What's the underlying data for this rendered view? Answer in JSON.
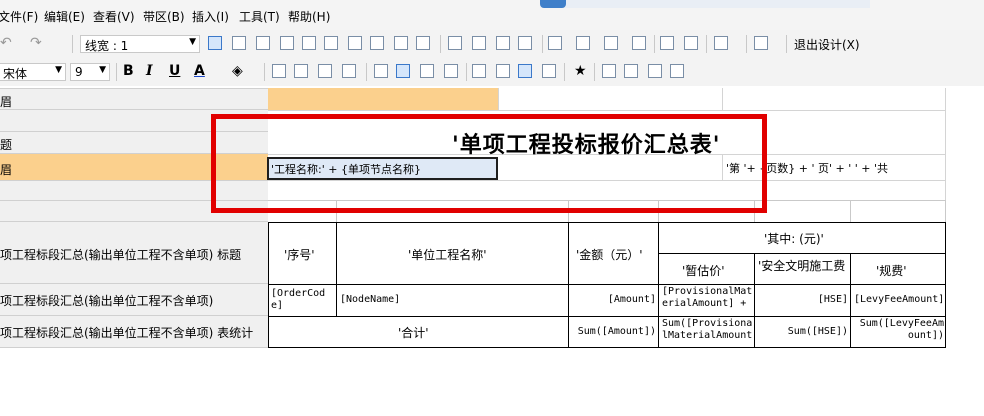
{
  "menu": [
    "文件(F)",
    "编辑(E)",
    "查看(V)",
    "带区(B)",
    "插入(I)",
    "工具(T)",
    "帮助(H)"
  ],
  "toolbar1": {
    "line_width_label": "线宽 : 1",
    "exit_design_label": "退出设计(X)"
  },
  "toolbar2": {
    "font_name": "宋体",
    "font_size": "9",
    "bold": "B",
    "italic": "I",
    "underline": "U",
    "font_color": "A"
  },
  "bands": {
    "row1": "眉",
    "row2": "题",
    "row3": "眉",
    "row5": "项工程标段汇总(输出单位工程不含单项) 标题",
    "row6": "项工程标段汇总(输出单位工程不含单项)",
    "row7": "项工程标段汇总(输出单位工程不含单项) 表统计"
  },
  "report": {
    "title": "'单项工程投标报价汇总表'",
    "project_name_cell": "'工程名称:' + {单项节点名称}",
    "page_cell": "'第 '+ {页数} + ' 页' + ' ' + '共"
  },
  "table": {
    "headers": {
      "seq": "'序号'",
      "unit_name": "'单位工程名称'",
      "amount": "'金额（元）'",
      "of_which": "'其中: (元)'",
      "provisional": "'暂估价'",
      "safety": "'安全文明施工费",
      "levy": "'规费'"
    },
    "detail": {
      "seq": "[OrderCode]",
      "unit_name": "[NodeName]",
      "amount": "[Amount]",
      "provisional": "[ProvisionalMaterialAmount] +",
      "safety": "[HSE]",
      "levy": "[LevyFeeAmount]"
    },
    "total": {
      "label": "'合计'",
      "amount": "Sum([Amount])",
      "provisional": "Sum([ProvisionalMaterialAmount",
      "safety": "Sum([HSE])",
      "levy": "Sum([LevyFeeAmount])"
    }
  },
  "colors": {
    "highlight": "#fbd08d",
    "annotation_red": "#e10000",
    "selection": "#dfe9f6"
  }
}
